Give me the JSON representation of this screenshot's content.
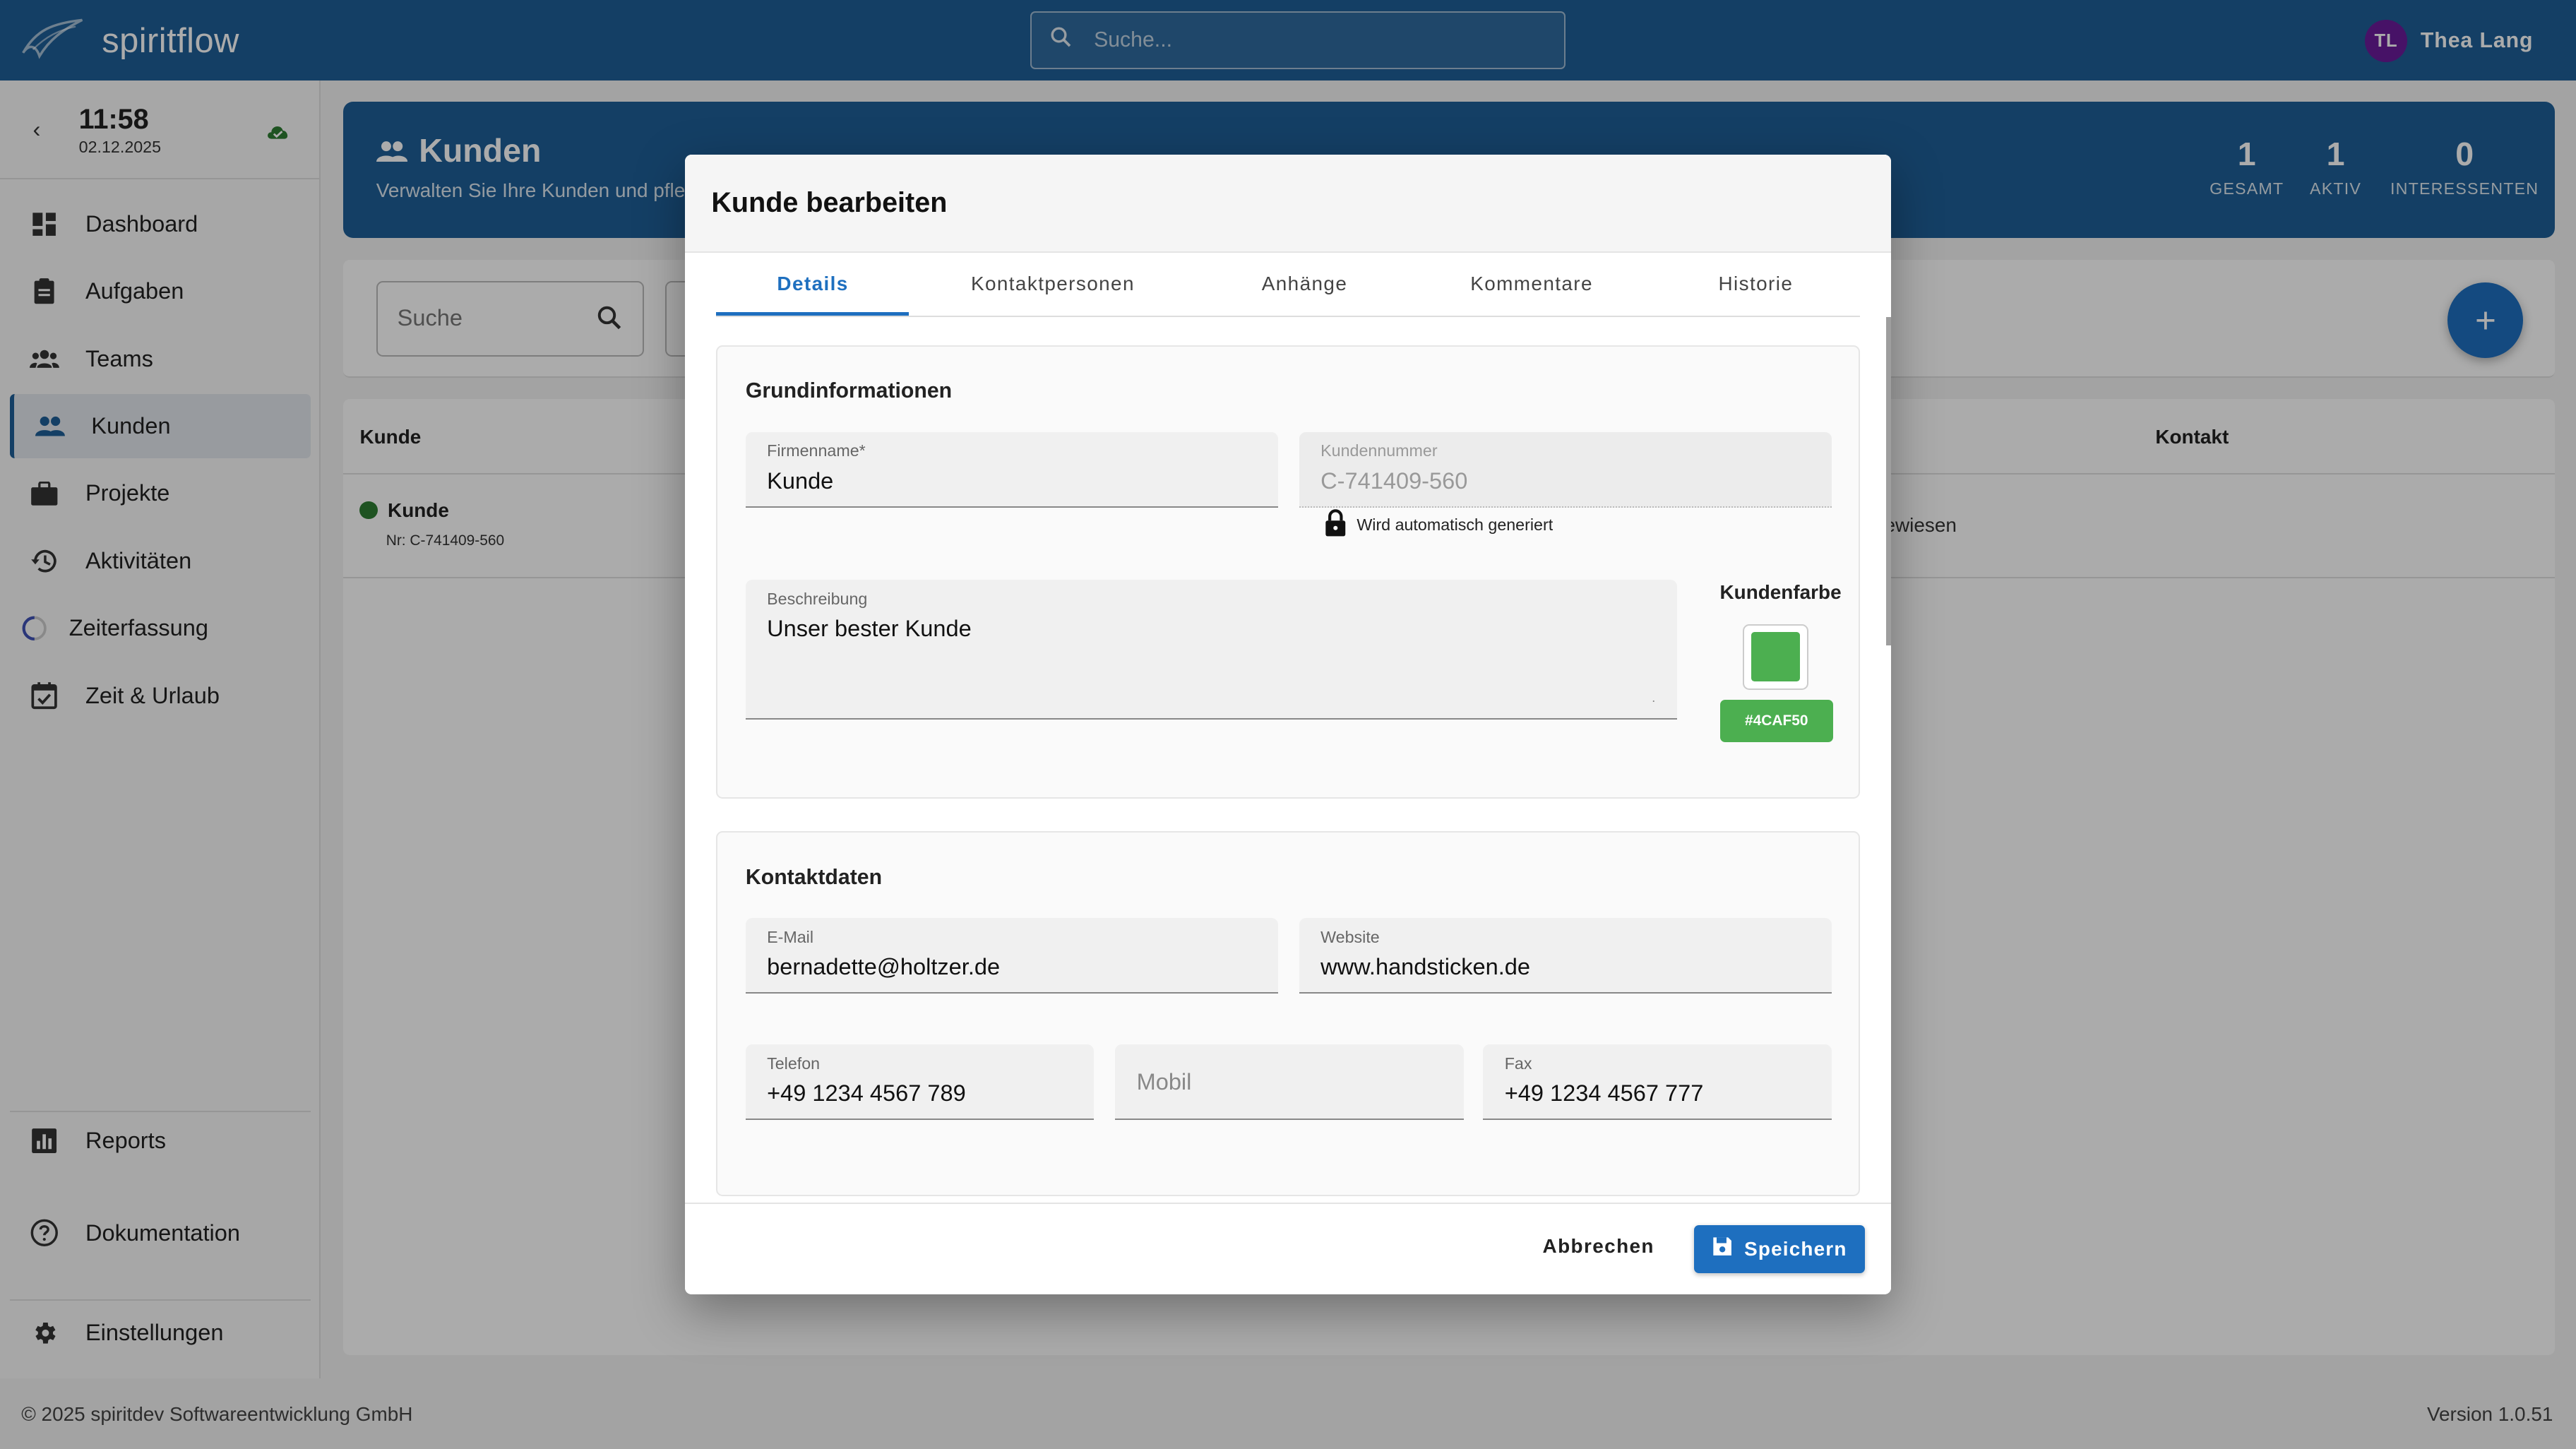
{
  "app": {
    "name": "spiritflow"
  },
  "topbar": {
    "search_placeholder": "Suche...",
    "user": {
      "initials": "TL",
      "name": "Thea Lang"
    }
  },
  "sidebar": {
    "time": "11:58",
    "date": "02.12.2025",
    "items": [
      {
        "label": "Dashboard",
        "icon": "dashboard-icon"
      },
      {
        "label": "Aufgaben",
        "icon": "clipboard-icon"
      },
      {
        "label": "Teams",
        "icon": "groups-icon"
      },
      {
        "label": "Kunden",
        "icon": "people-icon",
        "active": true
      },
      {
        "label": "Projekte",
        "icon": "briefcase-icon"
      },
      {
        "label": "Aktivitäten",
        "icon": "history-icon"
      },
      {
        "label": "Zeiterfassung",
        "icon": "spinner-icon"
      },
      {
        "label": "Zeit & Urlaub",
        "icon": "calendar-check-icon"
      }
    ],
    "bottom_items": [
      {
        "label": "Reports",
        "icon": "bar-chart-icon"
      },
      {
        "label": "Dokumentation",
        "icon": "help-icon"
      },
      {
        "label": "Einstellungen",
        "icon": "gear-icon"
      }
    ]
  },
  "page": {
    "title": "Kunden",
    "subtitle": "Verwalten Sie Ihre Kunden und pfleg",
    "stats": [
      {
        "value": "1",
        "label": "GESAMT"
      },
      {
        "value": "1",
        "label": "AKTIV"
      },
      {
        "value": "0",
        "label": "INTERESSENTEN"
      }
    ],
    "search_placeholder": "Suche",
    "fab_label": "+",
    "table": {
      "col_kunde": "Kunde",
      "col_kontakt": "Kontakt",
      "rows": [
        {
          "name": "Kunde",
          "nr": "Nr: C-741409-560",
          "kontakt_partial": "ewiesen"
        }
      ]
    }
  },
  "modal": {
    "title": "Kunde bearbeiten",
    "tabs": [
      "Details",
      "Kontaktpersonen",
      "Anhänge",
      "Kommentare",
      "Historie"
    ],
    "grundinfo": {
      "title": "Grundinformationen",
      "firmenname_label": "Firmenname*",
      "firmenname_value": "Kunde",
      "kundennummer_label": "Kundennummer",
      "kundennummer_value": "C-741409-560",
      "auto_hint": "Wird automatisch generiert",
      "beschreibung_label": "Beschreibung",
      "beschreibung_value": "Unser bester Kunde",
      "kundenfarbe_label": "Kundenfarbe",
      "kundenfarbe_value": "#4CAF50"
    },
    "kontakt": {
      "title": "Kontaktdaten",
      "email_label": "E-Mail",
      "email_value": "bernadette@holtzer.de",
      "website_label": "Website",
      "website_value": "www.handsticken.de",
      "telefon_label": "Telefon",
      "telefon_value": "+49 1234 4567 789",
      "mobil_placeholder": "Mobil",
      "fax_label": "Fax",
      "fax_value": "+49 1234 4567 777"
    },
    "cancel_label": "Abbrechen",
    "save_label": "Speichern"
  },
  "footer": {
    "copyright": "© 2025 spiritdev Softwareentwicklung GmbH",
    "version": "Version 1.0.51"
  },
  "colors": {
    "primary": "#1e5f97",
    "accent": "#1e6fbf",
    "customer_color": "#4CAF50",
    "status_active": "#2e7d32"
  }
}
